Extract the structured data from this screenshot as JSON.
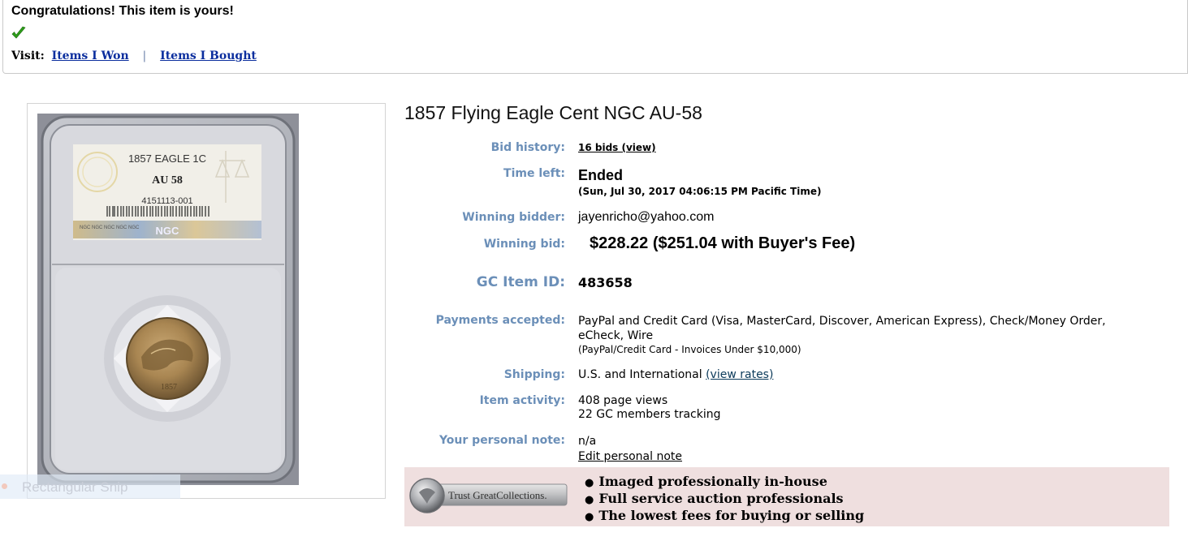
{
  "banner": {
    "title": "Congratulations! This item is yours!",
    "visit_label": "Visit:",
    "items_won": "Items I Won",
    "separator": "|",
    "items_bought": "Items I Bought"
  },
  "slab": {
    "line1": "1857 EAGLE 1C",
    "grade": "AU 58",
    "cert": "4151113-001",
    "brand": "NGC",
    "hologram_text": "NGC NGC NGC NGC NGC"
  },
  "ghost_overlay": {
    "text": "Rectangular Snip"
  },
  "item": {
    "title": "1857 Flying Eagle Cent NGC AU-58",
    "bid_history_label": "Bid history:",
    "bid_history_value": "16 bids (view)",
    "time_left_label": "Time left:",
    "time_left_value": "Ended",
    "time_left_detail": "(Sun, Jul 30, 2017 04:06:15 PM Pacific Time)",
    "winning_bidder_label": "Winning bidder:",
    "winning_bidder_value": "jayenricho@yahoo.com",
    "winning_bid_label": "Winning bid:",
    "winning_bid_value": "$228.22 ($251.04 with Buyer's Fee)",
    "gc_item_id_label": "GC Item ID:",
    "gc_item_id_value": "483658",
    "payments_label": "Payments accepted:",
    "payments_line1": "PayPal and Credit Card (Visa, MasterCard, Discover, American Express), Check/Money Order,",
    "payments_line2": "eCheck, Wire",
    "payments_note": "(PayPal/Credit Card - Invoices Under $10,000)",
    "shipping_label": "Shipping:",
    "shipping_value": "U.S. and International",
    "shipping_link": "(view rates)",
    "activity_label": "Item activity:",
    "activity_views": "408 page views",
    "activity_tracking": "22 GC members tracking",
    "note_label": "Your personal note:",
    "note_value": "n/a",
    "note_edit": "Edit personal note"
  },
  "promo": {
    "logo_text": "Trust GreatCollections.",
    "bullets": [
      "Imaged professionally in-house",
      "Full service auction professionals",
      "The lowest fees for buying or selling"
    ]
  },
  "colors": {
    "label_blue": "#6b8fb8",
    "link_blue": "#0b2e9e",
    "visited_purple": "#7d1f7d",
    "promo_bg": "#efdfdf",
    "check_green": "#2e9e1a"
  }
}
